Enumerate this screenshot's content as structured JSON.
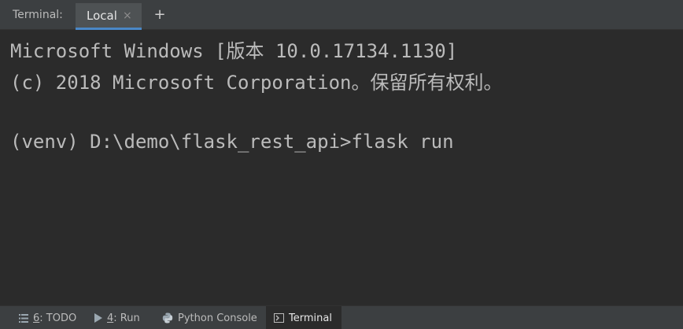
{
  "tabbar": {
    "title": "Terminal:",
    "tabs": [
      {
        "label": "Local",
        "active": true,
        "close_glyph": "×"
      }
    ],
    "add_glyph": "+"
  },
  "terminal": {
    "lines": [
      "Microsoft Windows [版本 10.0.17134.1130]",
      "(c) 2018 Microsoft Corporation。保留所有权利。",
      "(venv) D:\\demo\\flask_rest_api>flask run"
    ]
  },
  "toolbar": {
    "items": [
      {
        "number": "6",
        "label": ": TODO",
        "icon": "todo-list-icon"
      },
      {
        "number": "4",
        "label": ": Run",
        "icon": "run-icon"
      },
      {
        "label": "Python Console",
        "icon": "python-icon"
      },
      {
        "label": "Terminal",
        "icon": "terminal-icon",
        "active": true
      }
    ]
  },
  "colors": {
    "background": "#2b2b2b",
    "chrome": "#3c3f41",
    "text": "#bbbbbb",
    "accent": "#4a88c7"
  }
}
